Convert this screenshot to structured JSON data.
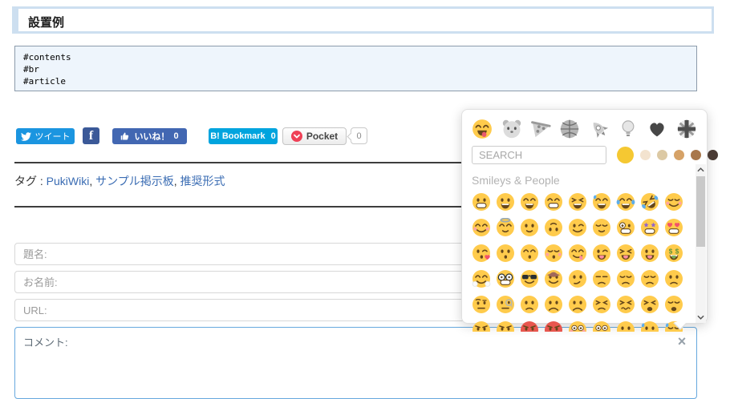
{
  "page": {
    "title": "設置例"
  },
  "code_block": {
    "lines": [
      "#contents",
      "#br",
      "#article"
    ]
  },
  "social": {
    "tweet": {
      "label": "ツイート"
    },
    "facebook": {
      "label": "f"
    },
    "like": {
      "label": "いいね！",
      "count": "0"
    },
    "hatena": {
      "label": "B! Bookmark",
      "count": "0"
    },
    "pocket": {
      "label": "Pocket",
      "count": "0"
    }
  },
  "tags": {
    "label": "タグ :",
    "separator": ", ",
    "items": [
      "PukiWiki",
      "サンプル掲示板",
      "推奨形式"
    ]
  },
  "form": {
    "fields": [
      {
        "name": "subject",
        "placeholder": "題名:"
      },
      {
        "name": "name",
        "placeholder": "お名前:"
      },
      {
        "name": "url",
        "placeholder": "URL:"
      }
    ],
    "comment": {
      "placeholder": "コメント:"
    },
    "close_label": "×"
  },
  "emoji_picker": {
    "search_placeholder": "SEARCH",
    "section_title": "Smileys & People",
    "accent_colors": {
      "emoji_yellow": "#ffcb4c",
      "emoji_red": "#e8564e"
    },
    "tabs": [
      {
        "name": "smileys-people",
        "active": true
      },
      {
        "name": "animals-nature",
        "active": false
      },
      {
        "name": "food-drink",
        "active": false
      },
      {
        "name": "activity",
        "active": false
      },
      {
        "name": "travel-places",
        "active": false
      },
      {
        "name": "objects",
        "active": false
      },
      {
        "name": "symbols",
        "active": false
      },
      {
        "name": "flags",
        "active": false
      }
    ],
    "skin_tones": [
      "#f5c832",
      "#f3e3cf",
      "#dcc9a4",
      "#d6a267",
      "#a8774b",
      "#4a3b34"
    ],
    "emojis": [
      {
        "n": "grinning-face",
        "c": "😀",
        "e": "dot",
        "m": "grin"
      },
      {
        "n": "grinning-face-big-eyes",
        "c": "😃",
        "e": "dot",
        "m": "open"
      },
      {
        "n": "grinning-face-smiling-eyes",
        "c": "😄",
        "e": "happy",
        "m": "open"
      },
      {
        "n": "beaming-face",
        "c": "😁",
        "e": "happy",
        "m": "grin"
      },
      {
        "n": "grinning-squinting-face",
        "c": "😆",
        "e": "squint",
        "m": "open"
      },
      {
        "n": "grinning-face-with-sweat",
        "c": "😅",
        "e": "happy",
        "m": "open",
        "x": "sweat"
      },
      {
        "n": "face-with-tears-of-joy",
        "c": "😂",
        "e": "happy",
        "m": "open",
        "x": "tears"
      },
      {
        "n": "rolling-on-the-floor-laughing",
        "c": "🤣",
        "e": "squint",
        "m": "open",
        "x": "tears",
        "r": -35
      },
      {
        "n": "smiling-face",
        "c": "☺️",
        "e": "closed",
        "m": "smile",
        "x": "blush"
      },
      {
        "n": "smiling-face-smiling-eyes",
        "c": "😊",
        "e": "happy",
        "m": "smile",
        "x": "blush"
      },
      {
        "n": "smiling-face-with-halo",
        "c": "😇",
        "e": "happy",
        "m": "small",
        "x": "halo"
      },
      {
        "n": "slightly-smiling-face",
        "c": "🙂",
        "e": "dot",
        "m": "small"
      },
      {
        "n": "upside-down-face",
        "c": "🙃",
        "e": "dot",
        "m": "small",
        "r": 180
      },
      {
        "n": "winking-face",
        "c": "😉",
        "e": "wink",
        "m": "smile"
      },
      {
        "n": "relieved-face",
        "c": "😌",
        "e": "closed",
        "m": "small"
      },
      {
        "n": "zany-face",
        "c": "🤪",
        "e": "big",
        "m": "grin"
      },
      {
        "n": "star-struck",
        "c": "🤩",
        "e": "stars",
        "m": "grin"
      },
      {
        "n": "heart-eyes",
        "c": "😍",
        "e": "hearts",
        "m": "grin"
      },
      {
        "n": "face-blowing-kiss",
        "c": "😘",
        "e": "wink",
        "m": "kiss",
        "x": "heart"
      },
      {
        "n": "kissing-face",
        "c": "😗",
        "e": "dot",
        "m": "kiss"
      },
      {
        "n": "kissing-face-smiling-eyes",
        "c": "😙",
        "e": "happy",
        "m": "kiss"
      },
      {
        "n": "kissing-face-closed-eyes",
        "c": "😚",
        "e": "closed",
        "m": "kiss",
        "x": "blush"
      },
      {
        "n": "face-savoring-food",
        "c": "😋",
        "e": "happy",
        "m": "smile",
        "x": "tongueside"
      },
      {
        "n": "winking-face-with-tongue",
        "c": "😜",
        "e": "wink",
        "m": "opentongue"
      },
      {
        "n": "squinting-face-with-tongue",
        "c": "😝",
        "e": "squint",
        "m": "opentongue"
      },
      {
        "n": "face-with-tongue",
        "c": "😛",
        "e": "dot",
        "m": "opentongue"
      },
      {
        "n": "money-mouth-face",
        "c": "🤑",
        "e": "dollar",
        "m": "open",
        "x": "money"
      },
      {
        "n": "hugging-face",
        "c": "🤗",
        "e": "happy",
        "m": "smile",
        "x": "hands"
      },
      {
        "n": "nerd-face",
        "c": "🤓",
        "e": "glasses",
        "m": "grin"
      },
      {
        "n": "smiling-face-with-sunglasses",
        "c": "😎",
        "e": "shades",
        "m": "smile"
      },
      {
        "n": "cowboy-hat-face",
        "c": "🤠",
        "e": "dot",
        "m": "smile",
        "x": "hat"
      },
      {
        "n": "smirking-face",
        "c": "😏",
        "e": "dot",
        "m": "smirk"
      },
      {
        "n": "unamused-face",
        "c": "😒",
        "e": "lid",
        "m": "sad"
      },
      {
        "n": "disappointed-face",
        "c": "😞",
        "e": "closed",
        "m": "sad"
      },
      {
        "n": "pensive-face",
        "c": "😔",
        "e": "closed",
        "m": "sad"
      },
      {
        "n": "worried-face",
        "c": "😟",
        "e": "dot",
        "m": "sad"
      },
      {
        "n": "face-with-raised-eyebrow",
        "c": "🤨",
        "e": "brow",
        "m": "neutral"
      },
      {
        "n": "face-with-monocle",
        "c": "🧐",
        "e": "monocle",
        "m": "neutral"
      },
      {
        "n": "confused-face",
        "c": "😕",
        "e": "dot",
        "m": "sad"
      },
      {
        "n": "slightly-frowning-face",
        "c": "🙁",
        "e": "dot",
        "m": "frown"
      },
      {
        "n": "frowning-face",
        "c": "☹️",
        "e": "dot",
        "m": "frown"
      },
      {
        "n": "persevering-face",
        "c": "😣",
        "e": "squint",
        "m": "sad"
      },
      {
        "n": "confounded-face",
        "c": "😖",
        "e": "squint",
        "m": "wavy"
      },
      {
        "n": "tired-face",
        "c": "😫",
        "e": "squint",
        "m": "openfrown"
      },
      {
        "n": "weary-face",
        "c": "😩",
        "e": "closed",
        "m": "openfrown"
      },
      {
        "n": "face-with-steam",
        "c": "😤",
        "e": "angry",
        "m": "sad"
      },
      {
        "n": "angry-face",
        "c": "😠",
        "e": "angry",
        "m": "sad"
      },
      {
        "n": "pouting-face",
        "c": "😡",
        "e": "angry",
        "m": "sad",
        "f": "#e8564e"
      },
      {
        "n": "face-with-symbols-on-mouth",
        "c": "🤬",
        "e": "angry",
        "m": "censored",
        "f": "#e8564e"
      },
      {
        "n": "flushed-face",
        "c": "😳",
        "e": "wide",
        "m": "neutral",
        "x": "blush"
      },
      {
        "n": "screaming-face",
        "c": "😱",
        "e": "wide",
        "m": "openfrown"
      },
      {
        "n": "fearful-face",
        "c": "😨",
        "e": "dot",
        "m": "openfrown"
      },
      {
        "n": "anxious-face-with-sweat",
        "c": "😰",
        "e": "dot",
        "m": "openfrown",
        "x": "sweat"
      },
      {
        "n": "sad-but-relieved-face",
        "c": "😥",
        "e": "closed",
        "m": "sad",
        "x": "sweat"
      }
    ]
  }
}
